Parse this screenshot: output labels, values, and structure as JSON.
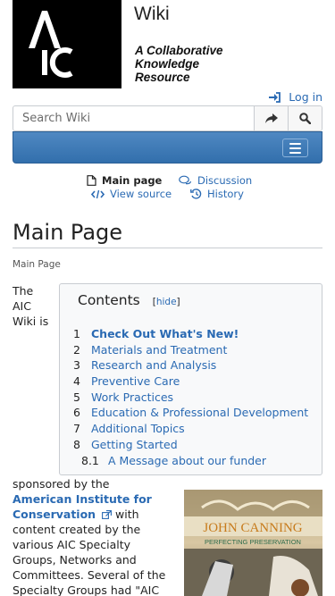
{
  "header": {
    "logo_text": "AIC",
    "site_title": "Wiki",
    "tagline": [
      "A Collaborative",
      "Knowledge",
      "Resource"
    ],
    "login_label": "Log in"
  },
  "search": {
    "placeholder": "Search Wiki",
    "go_icon": "share-arrow-icon",
    "search_icon": "magnifier-icon"
  },
  "navbar": {
    "menu_icon": "hamburger-icon",
    "color": "#3f7bb8"
  },
  "tabs": {
    "main_page": "Main page",
    "discussion": "Discussion",
    "view_source": "View source",
    "history": "History"
  },
  "page": {
    "title": "Main Page",
    "breadcrumb": "Main Page",
    "intro_lines": [
      "The",
      "AIC",
      "Wiki is"
    ],
    "body": {
      "line1": "sponsored by the",
      "org_link_line1": "American Institute for",
      "org_link_line2": "Conservation",
      "with": " with",
      "line3": "content created by the",
      "line4": "various AIC Specialty",
      "line5": "Groups, Networks and",
      "line6": "Committees. Several of the",
      "line7": "Specialty Groups had \"AIC"
    }
  },
  "toc": {
    "title": "Contents",
    "toggle_open": "[",
    "toggle": "hide",
    "toggle_close": "]",
    "items": [
      {
        "num": "1",
        "label": "Check Out What's New!"
      },
      {
        "num": "2",
        "label": "Materials and Treatment"
      },
      {
        "num": "3",
        "label": "Research and Analysis"
      },
      {
        "num": "4",
        "label": "Preventive Care"
      },
      {
        "num": "5",
        "label": "Work Practices"
      },
      {
        "num": "6",
        "label": "Education & Professional Development"
      },
      {
        "num": "7",
        "label": "Additional Topics"
      },
      {
        "num": "8",
        "label": "Getting Started"
      },
      {
        "num": "8.1",
        "label": "A Message about our funder"
      }
    ]
  },
  "sponsor_image": {
    "line1": "JOHN CANNING",
    "line2": "PERFECTING PRESERVATION"
  },
  "colors": {
    "link": "#2a6ab3",
    "navbar": "#3f7bb8",
    "border": "#c8ccd1"
  }
}
